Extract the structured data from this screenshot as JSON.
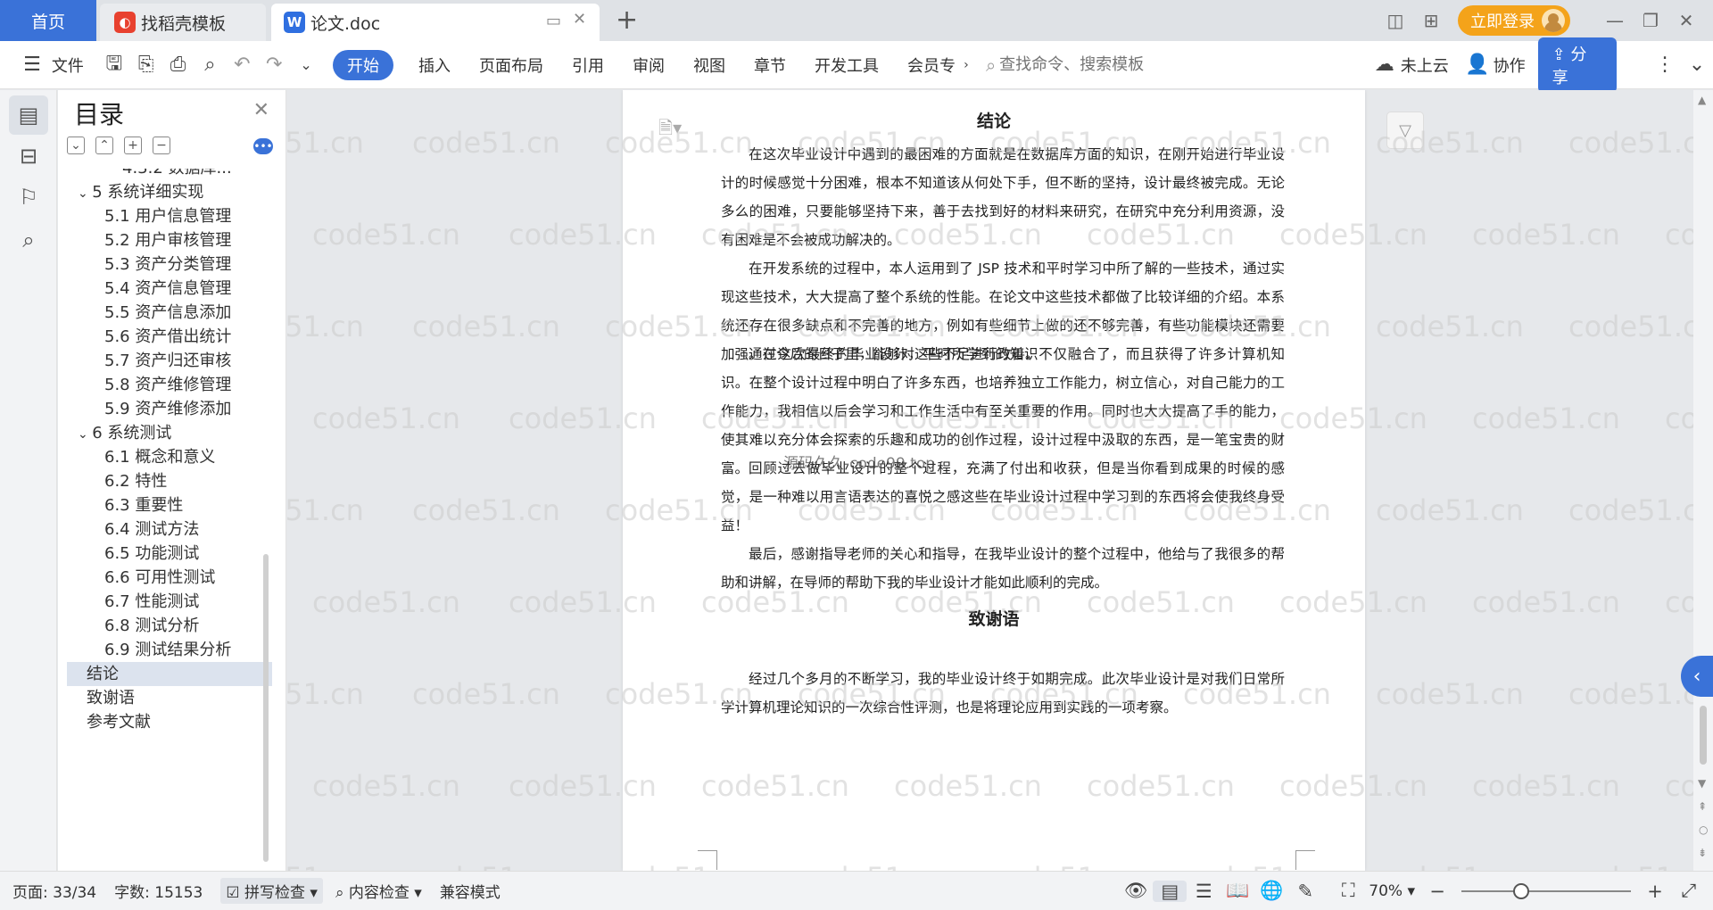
{
  "tabs": {
    "home": "首页",
    "template": "找稻壳模板",
    "document": "论文.doc"
  },
  "account": {
    "login_label": "立即登录"
  },
  "toolbar": {
    "file": "文件",
    "tabs": [
      "开始",
      "插入",
      "页面布局",
      "引用",
      "审阅",
      "视图",
      "章节",
      "开发工具",
      "会员专"
    ],
    "search_placeholder": "查找命令、搜索模板",
    "cloud": "未上云",
    "collab": "协作",
    "share": "分享"
  },
  "toc": {
    "title": "目录",
    "items": [
      {
        "label": "4.3.2 数据库...",
        "level": 3
      },
      {
        "label": "5 系统详细实现",
        "level": 1,
        "expanded": true
      },
      {
        "label": "5.1 用户信息管理",
        "level": 2
      },
      {
        "label": "5.2 用户审核管理",
        "level": 2
      },
      {
        "label": "5.3 资产分类管理",
        "level": 2
      },
      {
        "label": "5.4 资产信息管理",
        "level": 2
      },
      {
        "label": "5.5 资产信息添加",
        "level": 2
      },
      {
        "label": "5.6 资产借出统计",
        "level": 2
      },
      {
        "label": "5.7 资产归还审核",
        "level": 2
      },
      {
        "label": "5.8 资产维修管理",
        "level": 2
      },
      {
        "label": "5.9 资产维修添加",
        "level": 2
      },
      {
        "label": "6 系统测试",
        "level": 1,
        "expanded": true
      },
      {
        "label": "6.1 概念和意义",
        "level": 2
      },
      {
        "label": "6.2 特性",
        "level": 2
      },
      {
        "label": "6.3 重要性",
        "level": 2
      },
      {
        "label": "6.4 测试方法",
        "level": 2
      },
      {
        "label": "6.5  功能测试",
        "level": 2
      },
      {
        "label": "6.6 可用性测试",
        "level": 2
      },
      {
        "label": "6.7 性能测试",
        "level": 2
      },
      {
        "label": "6.8 测试分析",
        "level": 2
      },
      {
        "label": "6.9 测试结果分析",
        "level": 2
      },
      {
        "label": "结论",
        "level": 0,
        "selected": true
      },
      {
        "label": "致谢语",
        "level": 0
      },
      {
        "label": "参考文献",
        "level": 0
      }
    ]
  },
  "document": {
    "sections": [
      {
        "heading": "结论",
        "paragraphs": [
          "在这次毕业设计中遇到的最困难的方面就是在数据库方面的知识，在刚开始进行毕业设计的时候感觉十分困难，根本不知道该从何处下手，但不断的坚持，设计最终被完成。无论多么的困难，只要能够坚持下来，善于去找到好的材料来研究，在研究中充分利用资源，没有困难是不会被成功解决的。",
          "在开发系统的过程中，本人运用到了 JSP 技术和平时学习中所了解的一些技术，通过实现这些技术，大大提高了整个系统的性能。在论文中这些技术都做了比较详细的介绍。本系统还存在很多缺点和不完善的地方，例如有些细节上做的还不够完善，有些功能模块还需要加强。在今后的日子里，能够对这些不足进行改善。",
          "通过这次最终的毕业设计，平时所学到的知识不仅融合了，而且获得了许多计算机知识。在整个设计过程中明白了许多东西，也培养独立工作能力，树立信心，对自己能力的工作能力，我相信以后会学习和工作生活中有至关重要的作用。同时也大大提高了手的能力，使其难以充分体会探索的乐趣和成功的创作过程，设计过程中汲取的东西，是一笔宝贵的财富。",
          "回顾过去做毕业设计的整个过程，充满了付出和收获，但是当你看到成果的时候的感觉，是一种难以用言语表达的喜悦之感这些在毕业设计过程中学习到的东西将会使我终身受益！",
          "最后，感谢指导老师的关心和指导，在我毕业设计的整个过程中，他给与了我很多的帮助和讲解，在导师的帮助下我的毕业设计才能如此顺利的完成。"
        ]
      },
      {
        "heading": "致谢语",
        "paragraphs": [
          "经过几个多月的不断学习，我的毕业设计终于如期完成。此次毕业设计是对我们日常所学计算机理论知识的一次综合性评测，也是将理论应用到实践的一项考察。"
        ]
      }
    ],
    "overlay_text": "源码久久-code99.top",
    "watermark": "code51.cn"
  },
  "status": {
    "page": "页面: 33/34",
    "words": "字数: 15153",
    "spell": "拼写检查",
    "content_check": "内容检查",
    "compat": "兼容模式",
    "zoom": "70%"
  },
  "colors": {
    "accent": "#3a72d8",
    "login": "#f4a31a"
  }
}
